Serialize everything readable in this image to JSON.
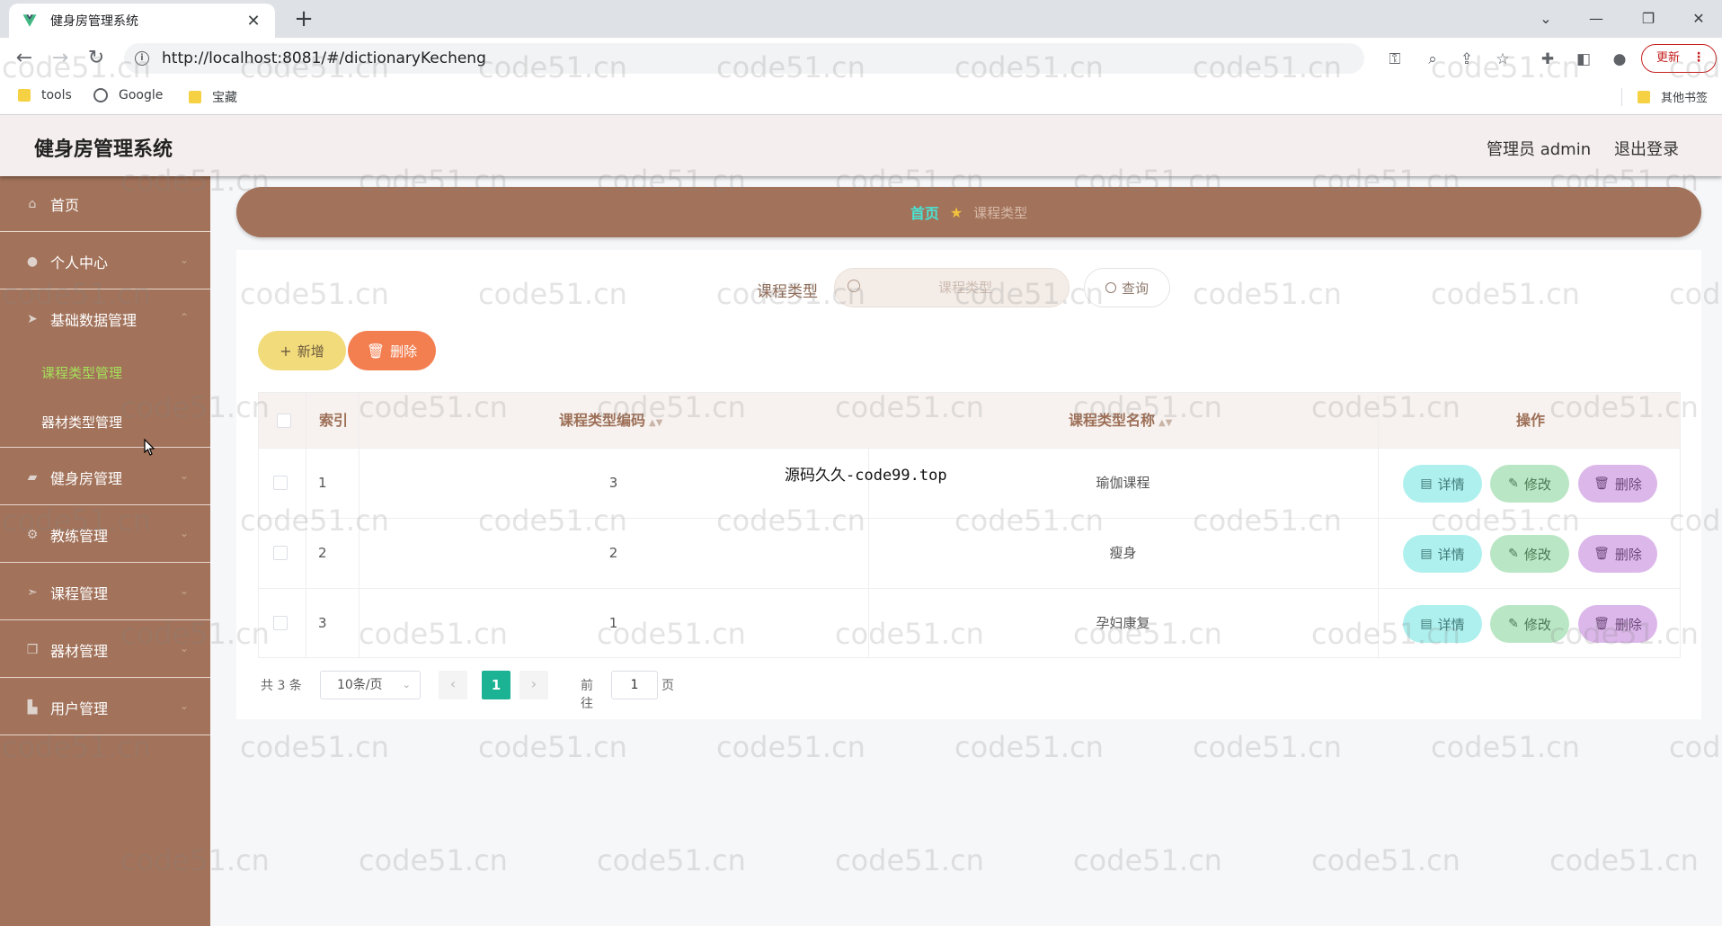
{
  "browser": {
    "tab_title": "健身房管理系统",
    "tab_close": "✕",
    "new_tab": "+",
    "url": "http://localhost:8081/#/dictionaryKecheng",
    "update_label": "更新",
    "bookmarks": [
      "tools",
      "Google",
      "宝藏"
    ],
    "other_bookmarks": "其他书签"
  },
  "header": {
    "title": "健身房管理系统",
    "admin": "管理员 admin",
    "logout": "退出登录"
  },
  "sidebar": {
    "items": [
      {
        "label": "首页",
        "icon": "home-icon"
      },
      {
        "label": "个人中心",
        "icon": "user-icon"
      },
      {
        "label": "基础数据管理",
        "icon": "send-icon"
      },
      {
        "label": "健身房管理",
        "icon": "chat-icon"
      },
      {
        "label": "教练管理",
        "icon": "settings-icon"
      },
      {
        "label": "课程管理",
        "icon": "send-icon"
      },
      {
        "label": "器材管理",
        "icon": "copy-icon"
      },
      {
        "label": "用户管理",
        "icon": "truck-icon"
      }
    ],
    "sub_items": [
      "课程类型管理",
      "器材类型管理"
    ]
  },
  "breadcrumb": {
    "home": "首页",
    "current": "课程类型"
  },
  "search": {
    "label": "课程类型",
    "placeholder": "课程类型",
    "query_label": "查询"
  },
  "actions": {
    "add_label": "新增",
    "delete_label": "删除"
  },
  "table": {
    "headers": {
      "index": "索引",
      "code": "课程类型编码",
      "name": "课程类型名称",
      "ops": "操作"
    },
    "rows": [
      {
        "index": "1",
        "code": "3",
        "name": "瑜伽课程"
      },
      {
        "index": "2",
        "code": "2",
        "name": "瘦身"
      },
      {
        "index": "3",
        "code": "1",
        "name": "孕妇康复"
      }
    ],
    "row_actions": {
      "detail": "详情",
      "edit": "修改",
      "delete": "删除"
    }
  },
  "overlay_text": "源码久久-code99.top",
  "pagination": {
    "total": "共 3 条",
    "page_size": "10条/页",
    "current_page": "1",
    "goto_label": "前往",
    "goto_value": "1",
    "page_suffix": "页"
  },
  "watermark": "code51.cn",
  "colors": {
    "sidebar": "#a2725a",
    "active_sub": "#a5e05a",
    "pager_active": "#1bb394"
  }
}
